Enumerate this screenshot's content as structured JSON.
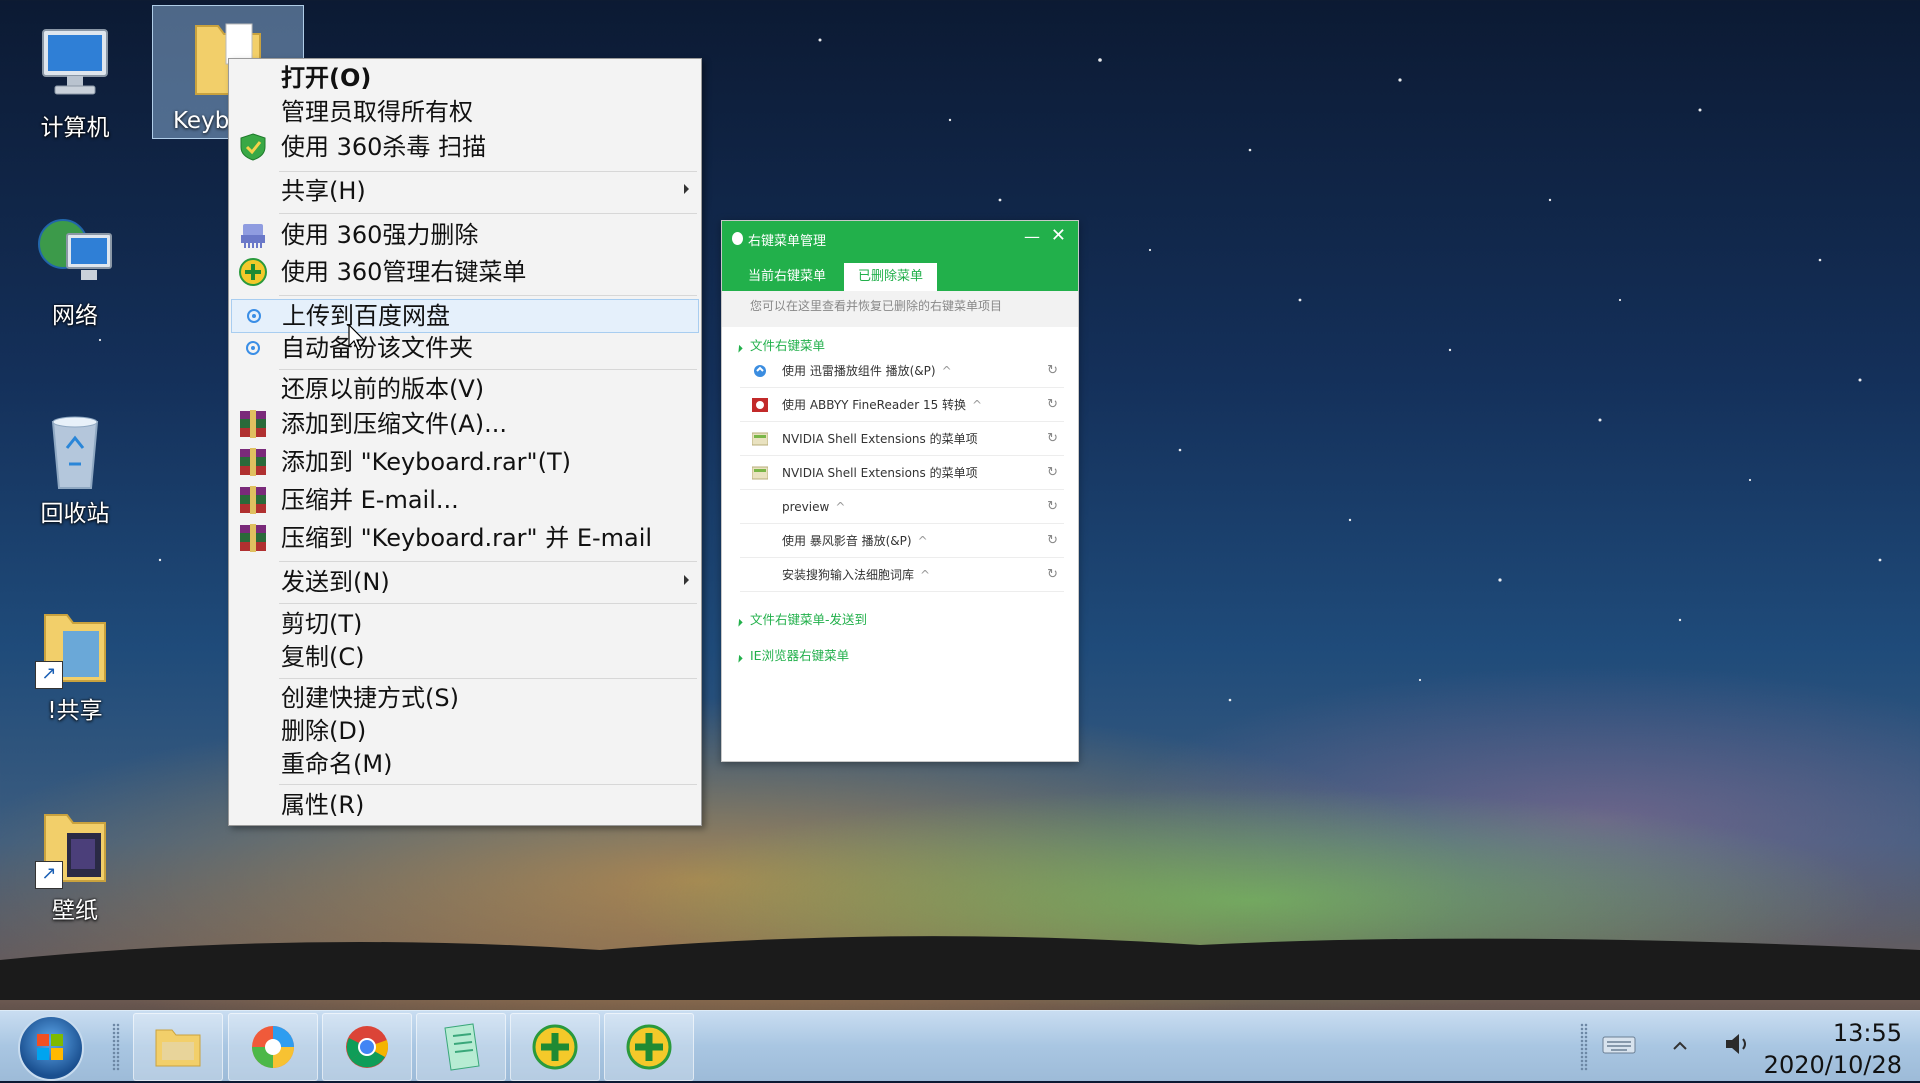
{
  "desktop_icons": [
    {
      "label": "计算机",
      "icon": "computer-icon"
    },
    {
      "label": "网络",
      "icon": "network-icon"
    },
    {
      "label": "回收站",
      "icon": "recycle-bin-icon"
    },
    {
      "label": "!共享",
      "icon": "shared-folder-icon"
    },
    {
      "label": "壁纸",
      "icon": "wallpaper-folder-icon"
    }
  ],
  "selected_folder": {
    "label": "Keyb",
    "icon": "folder-icon"
  },
  "context_menu": {
    "items": [
      {
        "label": "打开(O)",
        "icon": ""
      },
      {
        "label": "管理员取得所有权",
        "icon": ""
      },
      {
        "label": "使用 360杀毒 扫描",
        "icon": "360-antivirus-shield-icon"
      },
      {
        "label": "共享(H)",
        "icon": ""
      },
      {
        "label": "使用 360强力删除",
        "icon": "360-shredder-icon"
      },
      {
        "label": "使用 360管理右键菜单",
        "icon": "360-plus-icon"
      },
      {
        "label": "上传到百度网盘",
        "icon": "baidu-netdisk-icon"
      },
      {
        "label": "自动备份该文件夹",
        "icon": "baidu-netdisk-icon"
      },
      {
        "label": "还原以前的版本(V)",
        "icon": ""
      },
      {
        "label": "添加到压缩文件(A)...",
        "icon": "winrar-icon"
      },
      {
        "label": "添加到 \"Keyboard.rar\"(T)",
        "icon": "winrar-icon"
      },
      {
        "label": "压缩并 E-mail...",
        "icon": "winrar-icon"
      },
      {
        "label": "压缩到 \"Keyboard.rar\" 并 E-mail",
        "icon": "winrar-icon"
      },
      {
        "label": "发送到(N)",
        "icon": ""
      },
      {
        "label": "剪切(T)",
        "icon": ""
      },
      {
        "label": "复制(C)",
        "icon": ""
      },
      {
        "label": "创建快捷方式(S)",
        "icon": ""
      },
      {
        "label": "删除(D)",
        "icon": ""
      },
      {
        "label": "重命名(M)",
        "icon": ""
      },
      {
        "label": "属性(R)",
        "icon": ""
      }
    ]
  },
  "dialog": {
    "title": "右键菜单管理",
    "tabs": [
      "当前右键菜单",
      "已删除菜单"
    ],
    "active_tab": "已删除菜单",
    "hint": "您可以在这里查看并恢复已删除的右键菜单项目",
    "groups": [
      {
        "label": "文件右键菜单"
      },
      {
        "label": "文件右键菜单-发送到"
      },
      {
        "label": "IE浏览器右键菜单"
      }
    ],
    "rows": [
      {
        "label": "使用 迅雷播放组件 播放(&P)",
        "chevron": "^",
        "icon": "xunlei-icon"
      },
      {
        "label": "使用 ABBYY FineReader 15 转换",
        "chevron": "^",
        "icon": "abbyy-icon"
      },
      {
        "label": "NVIDIA Shell Extensions 的菜单项",
        "chevron": "",
        "icon": "nvidia-icon"
      },
      {
        "label": "NVIDIA Shell Extensions 的菜单项",
        "chevron": "",
        "icon": "nvidia-icon"
      },
      {
        "label": "preview",
        "chevron": "^",
        "icon": ""
      },
      {
        "label": "使用 暴风影音 播放(&P)",
        "chevron": "^",
        "icon": ""
      },
      {
        "label": "安装搜狗输入法细胞词库",
        "chevron": "^",
        "icon": ""
      }
    ],
    "restore_icon": "restore-icon"
  },
  "taskbar": {
    "time": "13:55",
    "date": "2020/10/28",
    "pinned": [
      {
        "name": "file-explorer",
        "icon": "file-explorer-icon"
      },
      {
        "name": "360-browser",
        "icon": "360-browser-icon"
      },
      {
        "name": "chrome",
        "icon": "chrome-icon"
      },
      {
        "name": "notes-app",
        "icon": "notes-app-icon"
      },
      {
        "name": "360-security",
        "icon": "360-plus-icon"
      },
      {
        "name": "360-security-2",
        "icon": "360-plus-icon"
      }
    ],
    "tray_icons": [
      "keyboard-icon",
      "show-hidden-icons-arrow",
      "volume-icon"
    ]
  },
  "colors": {
    "accent_360": "#22b04b",
    "menu_highlight": "#e5f0fb"
  }
}
